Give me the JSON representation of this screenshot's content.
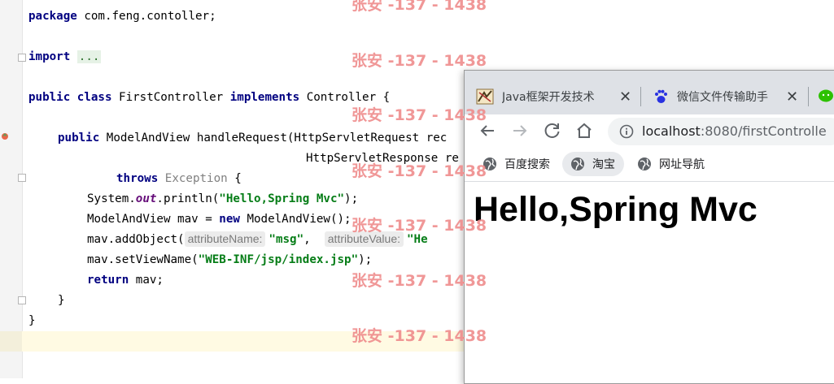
{
  "editor": {
    "lines": {
      "l1": {
        "kw": "package",
        "rest": " com.feng.contoller;"
      },
      "l2": {
        "kw": "import",
        "dots": "..."
      },
      "l3": {
        "kw1": "public",
        "kw2": "class",
        "name": " FirstController ",
        "kw3": "implements",
        "rest": " Controller {"
      },
      "l4": {
        "kw": "public",
        "rest": " ModelAndView handleRequest(HttpServletRequest rec"
      },
      "l5": {
        "text": "HttpServletResponse re"
      },
      "l6": {
        "kw": "throws",
        "exc": " Exception",
        "rest": " {"
      },
      "l7": {
        "pre": "System.",
        "field": "out",
        "mid": ".println(",
        "str": "\"Hello,Spring Mvc\"",
        "post": ");"
      },
      "l8": {
        "pre": "ModelAndView mav = ",
        "kw": "new",
        "post": " ModelAndView();"
      },
      "l9": {
        "pre": "mav.addObject(",
        "hint1": "attributeName:",
        "str1": "\"msg\"",
        "comma": ",  ",
        "hint2": "attributeValue:",
        "str2": "\"He"
      },
      "l10": {
        "pre": "mav.setViewName(",
        "str": "\"WEB-INF/jsp/index.jsp\"",
        "post": ");"
      },
      "l11": {
        "kw": "return",
        "rest": " mav;"
      },
      "l12": {
        "text": "}"
      },
      "l13": {
        "text": "}"
      }
    }
  },
  "watermark": "张安 -137 - 1438",
  "browser": {
    "tabs": [
      {
        "label": "Java框架开发技术",
        "icon": "java-favicon-icon"
      },
      {
        "label": "微信文件传输助手",
        "icon": "baidu-paw-icon"
      },
      {
        "icon": "wechat-icon"
      }
    ],
    "url": {
      "host": "localhost",
      "rest": ":8080/firstControlle"
    },
    "bookmarks": [
      "百度搜索",
      "淘宝",
      "网址导航"
    ],
    "page_heading": "Hello,Spring Mvc"
  },
  "colors": {
    "keyword": "#000080",
    "string": "#067d17",
    "field": "#660e7a",
    "watermark": "#ef8c8c"
  }
}
